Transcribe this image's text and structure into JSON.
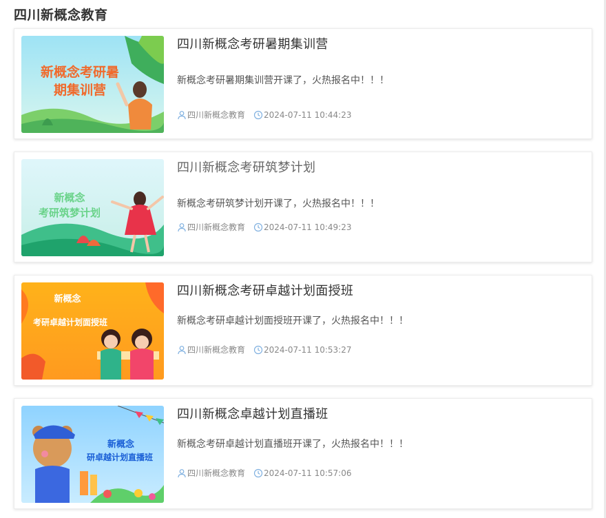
{
  "page": {
    "section_title": "四川新概念教育"
  },
  "colors": {
    "meta_icon": "#7fb0e0",
    "card_border": "#ececec"
  },
  "articles": [
    {
      "title": "四川新概念考研暑期集训营",
      "description": "新概念考研暑期集训营开课了，火热报名中！！！",
      "author": "四川新概念教育",
      "datetime": "2024-07-11 10:44:23",
      "thumb_text": [
        "新概念考研暑",
        "期集训营"
      ]
    },
    {
      "title": "四川新概念考研筑梦计划",
      "description": "新概念考研筑梦计划开课了，火热报名中！！！",
      "author": "四川新概念教育",
      "datetime": "2024-07-11 10:49:23",
      "thumb_text": [
        "新概念",
        "考研筑梦计划"
      ]
    },
    {
      "title": "四川新概念考研卓越计划面授班",
      "description": "新概念考研卓越计划面授班开课了，火热报名中！！！",
      "author": "四川新概念教育",
      "datetime": "2024-07-11 10:53:27",
      "thumb_text": [
        "新概念",
        "考研卓越计划面授班"
      ]
    },
    {
      "title": "四川新概念卓越计划直播班",
      "description": "新概念考研卓越计划直播班开课了，火热报名中！！！",
      "author": "四川新概念教育",
      "datetime": "2024-07-11 10:57:06",
      "thumb_text": [
        "新概念",
        "研卓越计划直播班"
      ]
    }
  ],
  "icons": {
    "author": "user-icon",
    "time": "clock-icon"
  }
}
